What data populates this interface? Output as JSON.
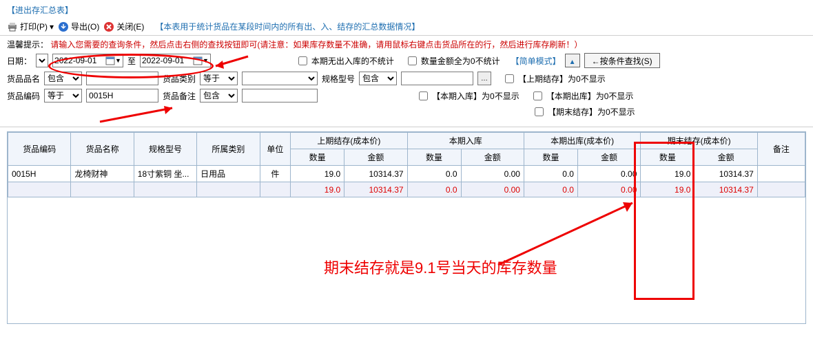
{
  "page": {
    "title": "【进出存汇总表】"
  },
  "toolbar": {
    "print": "打印(P)",
    "export": "导出(O)",
    "close": "关闭(E)",
    "desc": "【本表用于统计货品在某段时间内的所有出、入、结存的汇总数据情况】"
  },
  "hint": {
    "label": "温馨提示：",
    "text": "请输入您需要的查询条件，然后点击右侧的查找按钮即可(请注意：如果库存数量不准确，请用鼠标右键点击货品所在的行，然后进行库存刷新！）"
  },
  "filters": {
    "date_label": "日期：",
    "date_from": "2022-09-01",
    "date_to": "2022-09-01",
    "date_sep": "至",
    "cb_no_inout": "本期无出入库的不统计",
    "cb_zero": "数量金额全为0不统计",
    "simple_mode": "【简单模式】",
    "search_btn": "←按条件查找(S)",
    "name_label": "货品品名",
    "name_op": "包含",
    "name_val": "",
    "cat_label": "货品类别",
    "cat_op": "等于",
    "cat_val": "",
    "spec_label": "规格型号",
    "spec_op": "包含",
    "spec_val": "",
    "cb_prev_zero": "【上期结存】为0不显示",
    "code_label": "货品编码",
    "code_op": "等于",
    "code_val": "0015H",
    "remark_label": "货品备注",
    "remark_op": "包含",
    "remark_val": "",
    "cb_in_zero": "【本期入库】为0不显示",
    "cb_out_zero": "【本期出库】为0不显示",
    "cb_end_zero": "【期末结存】为0不显示"
  },
  "grid": {
    "headers": {
      "code": "货品编码",
      "name": "货品名称",
      "spec": "规格型号",
      "cat": "所属类别",
      "unit": "单位",
      "prev": "上期结存(成本价)",
      "in": "本期入库",
      "out": "本期出库(成本价)",
      "end": "期末结存(成本价)",
      "qty": "数量",
      "amt": "金额",
      "remark": "备注"
    },
    "rows": [
      {
        "code": "0015H",
        "name": "龙椅财神",
        "spec": "18寸紫铜  坐...",
        "cat": "日用品",
        "unit": "件",
        "prev_qty": "19.0",
        "prev_amt": "10314.37",
        "in_qty": "0.0",
        "in_amt": "0.00",
        "out_qty": "0.0",
        "out_amt": "0.00",
        "end_qty": "19.0",
        "end_amt": "10314.37",
        "remark": ""
      }
    ],
    "total": {
      "prev_qty": "19.0",
      "prev_amt": "10314.37",
      "in_qty": "0.0",
      "in_amt": "0.00",
      "out_qty": "0.0",
      "out_amt": "0.00",
      "end_qty": "19.0",
      "end_amt": "10314.37"
    }
  },
  "annotation": {
    "text": "期末结存就是9.1号当天的库存数量"
  }
}
